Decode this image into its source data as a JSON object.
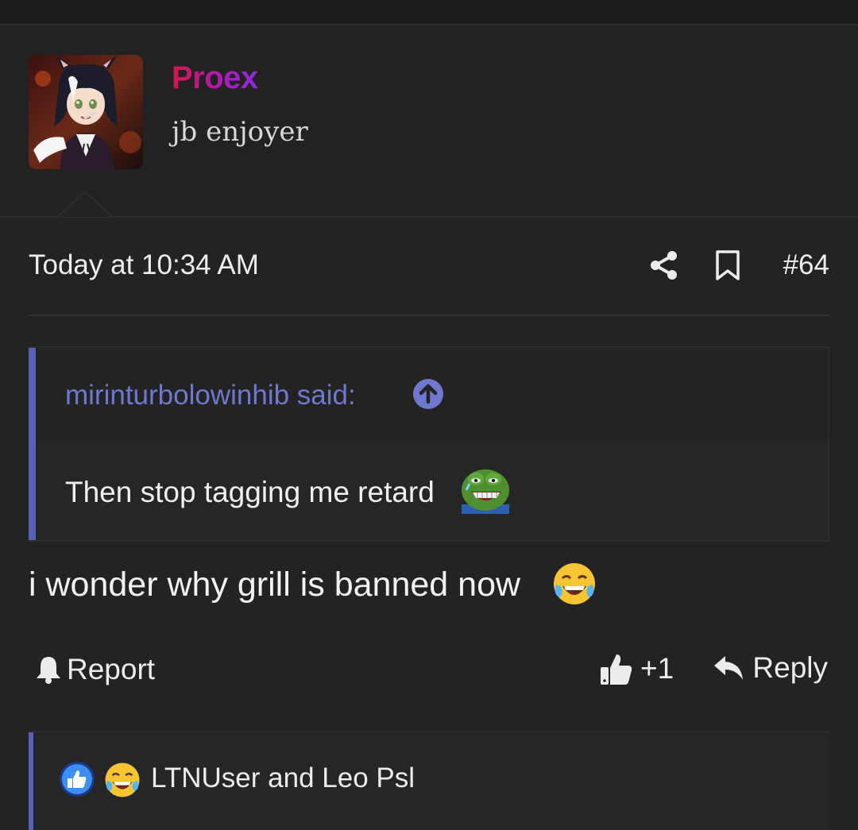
{
  "post": {
    "author": {
      "name": "Proex",
      "title": "jb enjoyer"
    },
    "timestamp": "Today at 10:34 AM",
    "post_number": "#64",
    "quote": {
      "author_label": "mirinturbolowinhib said:",
      "text": "Then stop tagging me retard"
    },
    "message": "i wonder why grill is banned now",
    "actions": {
      "report_label": "Report",
      "like_count": "+1",
      "reply_label": "Reply"
    },
    "reactions": {
      "summary": "LTNUser and Leo Psl"
    }
  },
  "colors": {
    "background": "#232323",
    "quote_accent": "#5a5fb8",
    "quote_author": "#6f78cf",
    "username_gradient_start": "#d4174a",
    "username_gradient_end": "#8a2be2"
  },
  "icons": [
    "avatar-image",
    "share-icon",
    "bookmark-icon",
    "arrow-up-circle-icon",
    "pepe-emoji",
    "laughing-crying-emoji",
    "bell-icon",
    "thumbs-up-icon",
    "reply-icon"
  ]
}
